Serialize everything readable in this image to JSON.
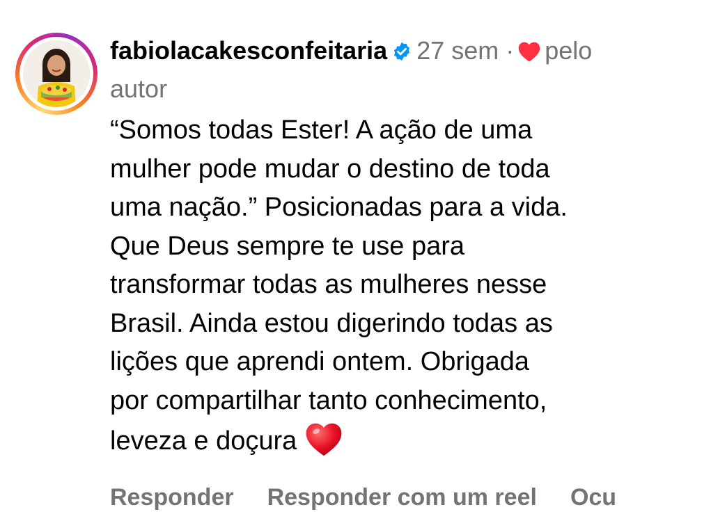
{
  "comment": {
    "username": "fabiolacakesconfeitaria",
    "time": "27 sem",
    "separator": "·",
    "liked_by_author_part1": "pelo",
    "liked_by_author_part2": "autor",
    "text": "“Somos todas Ester! A ação de uma\nmulher pode mudar o destino de toda\numa nação.” Posicionadas para a vida.\nQue Deus sempre te use para\ntransformar todas as mulheres nesse\nBrasil. Ainda estou digerindo todas as\nlições que aprendi ontem. Obrigada\npor compartilhar tanto conhecimento,\nleveza e doçura"
  },
  "actions": {
    "reply_label": "Responder",
    "reply_reel_label": "Responder com um reel",
    "hide_label": "Ocu"
  },
  "icons": {
    "verified": "verified-badge-icon",
    "liked": "heart-icon",
    "emoji": "red-heart-emoji"
  },
  "colors": {
    "verified": "#0095f6",
    "heart": "#ff3040",
    "secondary_text": "#737373"
  }
}
